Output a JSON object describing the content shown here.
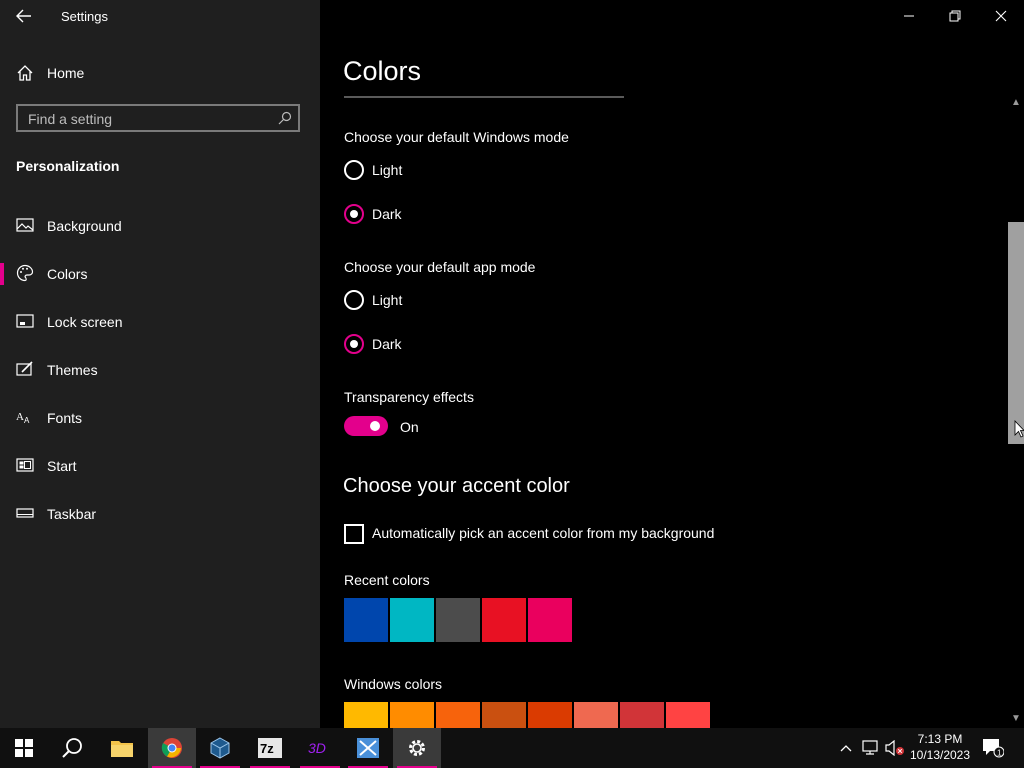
{
  "window": {
    "title": "Settings"
  },
  "sidebar": {
    "home_label": "Home",
    "search_placeholder": "Find a setting",
    "section_title": "Personalization",
    "items": [
      {
        "label": "Background",
        "icon": "picture-icon",
        "selected": false
      },
      {
        "label": "Colors",
        "icon": "palette-icon",
        "selected": true
      },
      {
        "label": "Lock screen",
        "icon": "lock-screen-icon",
        "selected": false
      },
      {
        "label": "Themes",
        "icon": "themes-icon",
        "selected": false
      },
      {
        "label": "Fonts",
        "icon": "fonts-icon",
        "selected": false
      },
      {
        "label": "Start",
        "icon": "start-icon",
        "selected": false
      },
      {
        "label": "Taskbar",
        "icon": "taskbar-icon",
        "selected": false
      }
    ]
  },
  "main": {
    "title": "Colors",
    "windows_mode": {
      "label": "Choose your default Windows mode",
      "options": [
        "Light",
        "Dark"
      ],
      "selected": "Dark"
    },
    "app_mode": {
      "label": "Choose your default app mode",
      "options": [
        "Light",
        "Dark"
      ],
      "selected": "Dark"
    },
    "transparency": {
      "label": "Transparency effects",
      "state": "On"
    },
    "accent": {
      "heading": "Choose your accent color",
      "auto_pick_label": "Automatically pick an accent color from my background",
      "auto_pick_checked": false,
      "recent_label": "Recent colors",
      "recent_colors": [
        "#0046ad",
        "#00b7c3",
        "#4c4c4c",
        "#e81123",
        "#ea005e"
      ],
      "windows_label": "Windows colors",
      "windows_colors": [
        "#ffb900",
        "#ff8c00",
        "#f7630c",
        "#ca5010",
        "#da3b01",
        "#ef6950",
        "#d13438",
        "#ff4343"
      ]
    }
  },
  "taskbar": {
    "apps": [
      "start-icon",
      "search-icon",
      "file-explorer-icon",
      "chrome-icon",
      "virtualbox-icon",
      "7zip-icon",
      "3d-viewer-icon",
      "snipping-icon",
      "settings-icon"
    ],
    "time": "7:13 PM",
    "date": "10/13/2023",
    "notification_count": "1"
  },
  "colors": {
    "accent": "#e3008c",
    "sidebar_bg": "#1f1f1f",
    "main_bg": "#000000"
  }
}
